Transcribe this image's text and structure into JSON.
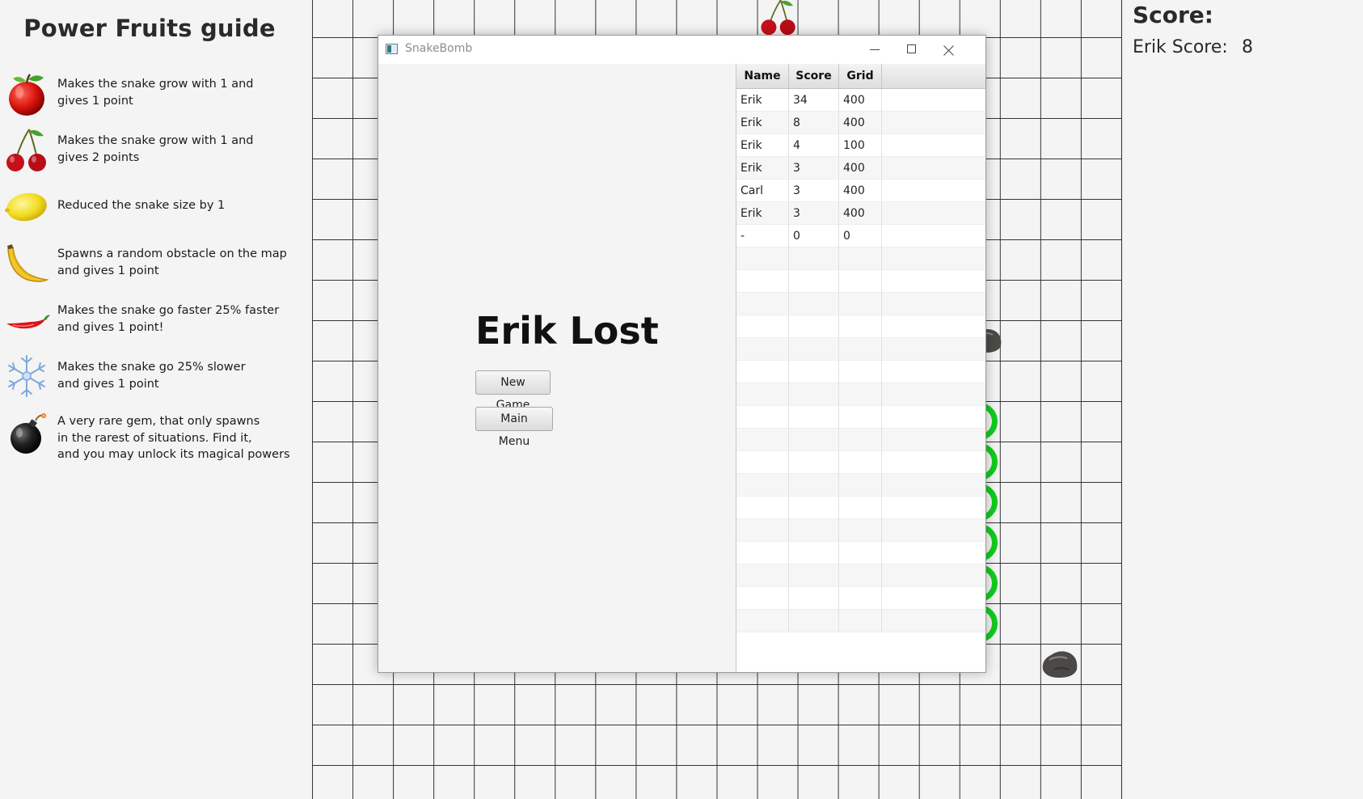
{
  "guide": {
    "title": "Power Fruits guide",
    "items": [
      {
        "icon": "apple-icon",
        "text": "Makes the snake grow with 1 and\ngives 1 point"
      },
      {
        "icon": "cherry-icon",
        "text": "Makes the snake grow with 1 and\ngives 2 points"
      },
      {
        "icon": "lemon-icon",
        "text": "Reduced the snake size by 1"
      },
      {
        "icon": "banana-icon",
        "text": "Spawns a random obstacle on the map\nand gives 1 point"
      },
      {
        "icon": "chili-pepper-icon",
        "text": "Makes the snake go faster 25% faster\nand gives 1 point!"
      },
      {
        "icon": "snowflake-icon",
        "text": "Makes the snake go 25% slower\nand gives 1 point"
      },
      {
        "icon": "bomb-icon",
        "text": "A very rare gem, that only spawns\nin the rarest of situations. Find it,\nand you may unlock its magical powers"
      }
    ]
  },
  "score": {
    "title": "Score:",
    "label": "Erik Score:",
    "value": "8"
  },
  "window": {
    "title": "SnakeBomb",
    "lost_text": "Erik Lost",
    "new_game_label": "New Game",
    "main_menu_label": "Main Menu"
  },
  "table": {
    "columns": [
      "Name",
      "Score",
      "Grid"
    ],
    "rows": [
      [
        "Erik",
        "34",
        "400"
      ],
      [
        "Erik",
        "8",
        "400"
      ],
      [
        "Erik",
        "4",
        "100"
      ],
      [
        "Erik",
        "3",
        "400"
      ],
      [
        "Carl",
        "3",
        "400"
      ],
      [
        "Erik",
        "3",
        "400"
      ],
      [
        "-",
        "0",
        "0"
      ]
    ]
  },
  "colors": {
    "snake": "#12cc1d",
    "grid_line": "#333333",
    "background": "#f4f4f4"
  }
}
